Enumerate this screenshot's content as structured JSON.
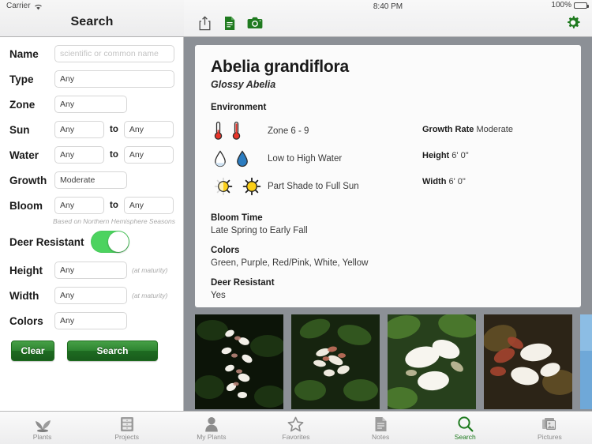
{
  "status": {
    "carrier": "Carrier",
    "wifi_icon": "wifi-icon",
    "time": "8:40 PM",
    "battery_percent": "100%"
  },
  "left_nav": {
    "title": "Search"
  },
  "toolbar": {
    "share_icon": "share-icon",
    "document_icon": "document-icon",
    "camera_icon": "camera-icon",
    "settings_icon": "gear-icon",
    "accent_color": "#1f7a1f"
  },
  "search_form": {
    "fields": [
      {
        "label": "Name",
        "value": "scientific or common name",
        "is_placeholder": true
      },
      {
        "label": "Type",
        "value": "Any",
        "is_placeholder": false
      },
      {
        "label": "Zone",
        "value": "Any",
        "is_placeholder": false
      }
    ],
    "range_fields": [
      {
        "label": "Sun",
        "from": "Any",
        "to": "Any",
        "separator": "to"
      },
      {
        "label": "Water",
        "from": "Any",
        "to": "Any",
        "separator": "to"
      }
    ],
    "growth": {
      "label": "Growth",
      "value": "Moderate"
    },
    "bloom": {
      "label": "Bloom",
      "from": "Any",
      "to": "Any",
      "separator": "to"
    },
    "seasons_note": "Based on Northern Hemisphere Seasons",
    "deer_resistant": {
      "label": "Deer Resistant",
      "enabled": true
    },
    "measure_fields": [
      {
        "label": "Height",
        "value": "Any",
        "hint": "(at maturity)"
      },
      {
        "label": "Width",
        "value": "Any",
        "hint": "(at maturity)"
      }
    ],
    "colors_field": {
      "label": "Colors",
      "value": "Any"
    },
    "buttons": {
      "clear": "Clear",
      "search": "Search",
      "color": "#2e8431"
    }
  },
  "plant": {
    "scientific_name": "Abelia grandiflora",
    "common_name": "Glossy Abelia",
    "environment_heading": "Environment",
    "environment_rows": [
      {
        "icon": "thermometer-icon",
        "text": "Zone 6 - 9"
      },
      {
        "icon": "water-drop-icon",
        "text": "Low to High Water"
      },
      {
        "icon": "sun-icon",
        "text": "Part Shade to Full Sun"
      }
    ],
    "stats": [
      {
        "label": "Growth Rate",
        "value": "Moderate"
      },
      {
        "label": "Height",
        "value": "6' 0\""
      },
      {
        "label": "Width",
        "value": "6' 0\""
      }
    ],
    "bloom_time": {
      "heading": "Bloom Time",
      "value": "Late Spring to Early Fall"
    },
    "colors": {
      "heading": "Colors",
      "value": "Green, Purple, Red/Pink, White, Yellow"
    },
    "deer": {
      "heading": "Deer Resistant",
      "value": "Yes"
    }
  },
  "gallery": {
    "photos": [
      {
        "name": "abelia-photo-1",
        "bg": "#0c1408",
        "leaf": "#1c3312",
        "petal": "#f2efe8",
        "accent": "#c08a7e"
      },
      {
        "name": "abelia-photo-2",
        "bg": "#16240f",
        "leaf": "#32561f",
        "petal": "#eeeade",
        "accent": "#c2705c"
      },
      {
        "name": "abelia-photo-3",
        "bg": "#27401c",
        "leaf": "#49762c",
        "petal": "#f7f5ef",
        "accent": "#d9cfae"
      },
      {
        "name": "abelia-photo-4",
        "bg": "#2c2417",
        "leaf": "#5c4a24",
        "petal": "#f4f1e9",
        "accent": "#a4442f"
      },
      {
        "name": "abelia-photo-5",
        "bg": "#6fa8d8",
        "leaf": "#4e7a2a",
        "petal": "#f8f7f2",
        "accent": "#b4452f"
      }
    ]
  },
  "tabbar": {
    "tabs": [
      {
        "label": "Plants",
        "icon": "seedling-icon",
        "active": false
      },
      {
        "label": "Projects",
        "icon": "drawers-icon",
        "active": false
      },
      {
        "label": "My Plants",
        "icon": "person-icon",
        "active": false
      },
      {
        "label": "Favorites",
        "icon": "star-icon",
        "active": false
      },
      {
        "label": "Notes",
        "icon": "note-icon",
        "active": false
      },
      {
        "label": "Search",
        "icon": "magnifier-icon",
        "active": true
      },
      {
        "label": "Pictures",
        "icon": "photos-icon",
        "active": false
      }
    ],
    "active_color": "#1d7a1d",
    "inactive_color": "#8b8b8b"
  }
}
